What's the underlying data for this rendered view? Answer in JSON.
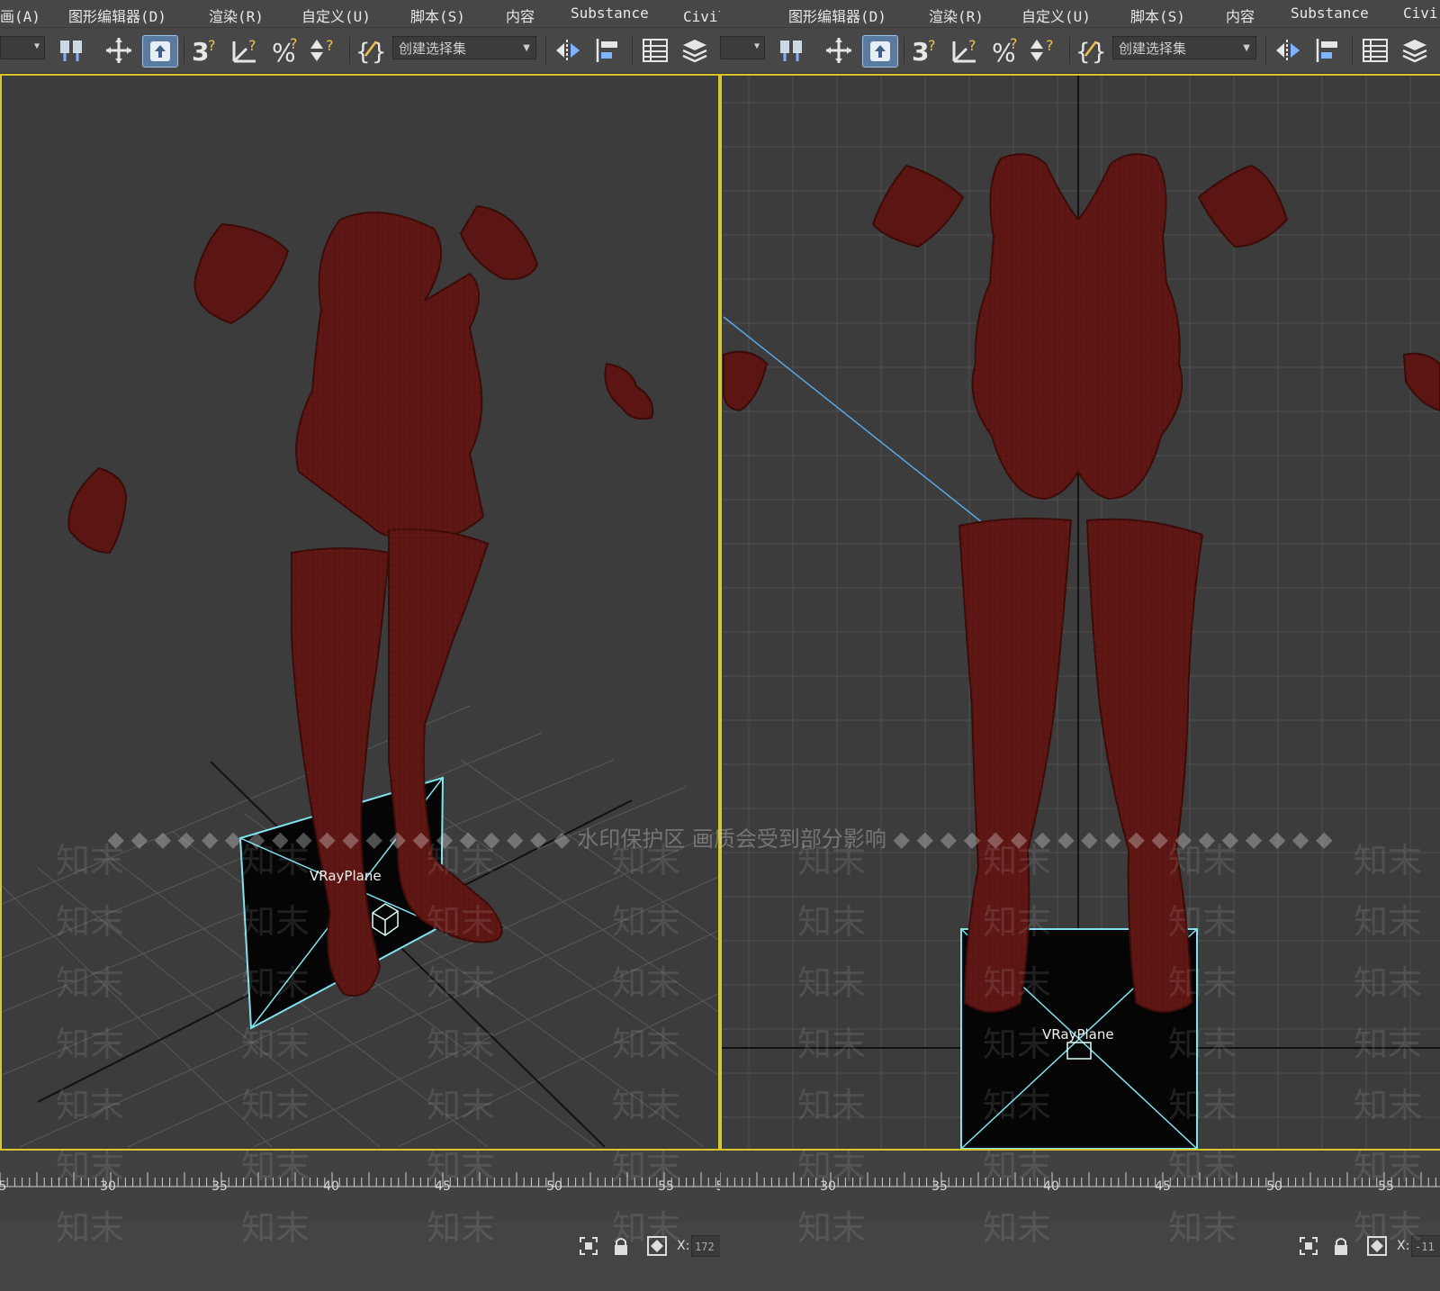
{
  "menu": {
    "items": [
      "画(A)",
      "图形编辑器(D)",
      "渲染(R)",
      "自定义(U)",
      "脚本(S)",
      "内容",
      "Substance",
      "Civil画(A)",
      "图形编辑器(D)",
      "渲染(R)",
      "自定义(U)",
      "脚本(S)",
      "内容",
      "Substance",
      "Civi"
    ]
  },
  "toolbar": {
    "selection_set_placeholder": "创建选择集",
    "selection_set_placeholder_2": "创建选择集"
  },
  "viewports": {
    "left_object_label": "VRayPlane",
    "right_object_label": "VRayPlane"
  },
  "timeline": {
    "left_ticks": [
      "5",
      "30",
      "35",
      "40",
      "45",
      "50",
      "55",
      "5"
    ],
    "right_ticks": [
      "30",
      "35",
      "40",
      "45",
      "50",
      "55"
    ]
  },
  "status": {
    "coord_x_label_left": "X:",
    "coord_x_value_left": "172",
    "coord_x_label_right": "X:",
    "coord_x_value_right": "-11"
  },
  "watermark": {
    "text": "知末",
    "banner": "◆ ◆ ◆ ◆ ◆ ◆ ◆ ◆ ◆ ◆ ◆ ◆ ◆ ◆ ◆ ◆ ◆ ◆ ◆ ◆ 水印保护区  画质会受到部分影响 ◆ ◆ ◆ ◆ ◆ ◆ ◆ ◆ ◆ ◆ ◆ ◆ ◆ ◆ ◆ ◆ ◆ ◆ ◆"
  },
  "colors": {
    "model": "#5b1512",
    "viewport_border": "#d9c52d",
    "grid": "#4d4d4d",
    "helper": "#7fe3f0"
  }
}
